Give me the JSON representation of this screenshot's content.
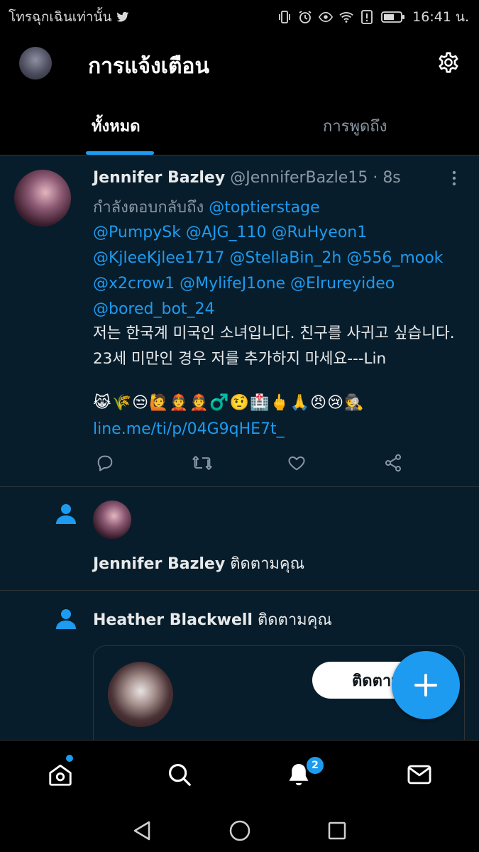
{
  "status_bar": {
    "left_text": "โทรฉุกเฉินเท่านั้น",
    "time": "16:41 น."
  },
  "header": {
    "title": "การแจ้งเตือน",
    "tabs": [
      {
        "label": "ทั้งหมด",
        "active": true
      },
      {
        "label": "การพูดถึง",
        "active": false
      }
    ]
  },
  "tweet": {
    "name": "Jennifer Bazley",
    "handle": "@JenniferBazle15",
    "time": "· 8s",
    "reply_prefix": "กำลังตอบกลับถึง",
    "reply_first": "@toptierstage",
    "mentions_lines": [
      "@PumpySk @AJG_110 @RuHyeon1",
      "@KjleeKjlee1717 @StellaBin_2h @556_mook",
      "@x2crow1 @MylifeJ1one @Elrureyideo",
      "@bored_bot_24"
    ],
    "body": "저는 한국계 미국인 소녀입니다. 친구를 사귀고 싶습니다. 23세 미만인 경우 저를 추가하지 마세요---Lin",
    "emojis": "😹🌾😒🙋👲👲♂️🤨🏥🖕🙏😠😢🕵️",
    "link": "line.me/ti/p/04G9qHE7t_"
  },
  "notifications": [
    {
      "name": "Jennifer Bazley",
      "action": "ติดตามคุณ"
    },
    {
      "name": "Heather Blackwell",
      "action": "ติดตามคุณ"
    }
  ],
  "card": {
    "follow_label": "ติดตาม"
  },
  "bottom_nav": {
    "notif_badge": "2"
  },
  "colors": {
    "accent": "#1d9bf0",
    "background": "#081d2b",
    "muted": "#8b98a5"
  }
}
